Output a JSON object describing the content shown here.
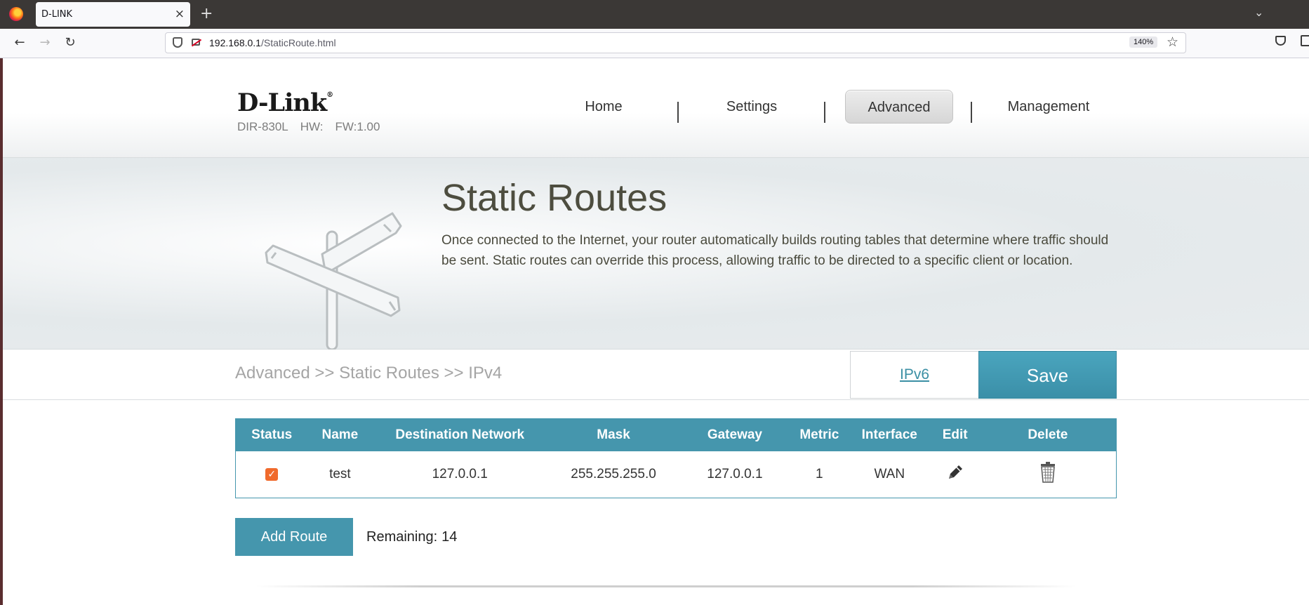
{
  "browser": {
    "tab_title": "D-LINK",
    "tab_close": "×",
    "new_tab": "+",
    "url_host": "192.168.0.1",
    "url_path": "/StaticRoute.html",
    "zoom": "140%"
  },
  "header": {
    "logo": "D-Link",
    "logo_mark": "®",
    "model": "DIR-830L",
    "hw": "HW:",
    "fw": "FW:1.00",
    "nav": [
      {
        "label": "Home",
        "active": false
      },
      {
        "label": "Settings",
        "active": false
      },
      {
        "label": "Advanced",
        "active": true
      },
      {
        "label": "Management",
        "active": false
      }
    ]
  },
  "hero": {
    "title": "Static Routes",
    "description": "Once connected to the Internet, your router automatically builds routing tables that determine where traffic should be sent. Static routes can override this process, allowing traffic to be directed to a specific client or location."
  },
  "subbar": {
    "breadcrumb": "Advanced >> Static Routes >> IPv4",
    "ipv6_link": "IPv6",
    "save_label": "Save"
  },
  "table": {
    "headers": [
      "Status",
      "Name",
      "Destination Network",
      "Mask",
      "Gateway",
      "Metric",
      "Interface",
      "Edit",
      "Delete"
    ],
    "rows": [
      {
        "status_checked": true,
        "name": "test",
        "destination": "127.0.0.1",
        "mask": "255.255.255.0",
        "gateway": "127.0.0.1",
        "metric": "1",
        "interface": "WAN",
        "edit_icon": "pencil-icon",
        "delete_icon": "trash-icon"
      }
    ]
  },
  "actions": {
    "add_route_label": "Add Route",
    "remaining_label": "Remaining:",
    "remaining_count": "14"
  },
  "colors": {
    "accent": "#4596ad",
    "checkbox": "#f06a2c",
    "title_text": "#4d4d3f"
  }
}
